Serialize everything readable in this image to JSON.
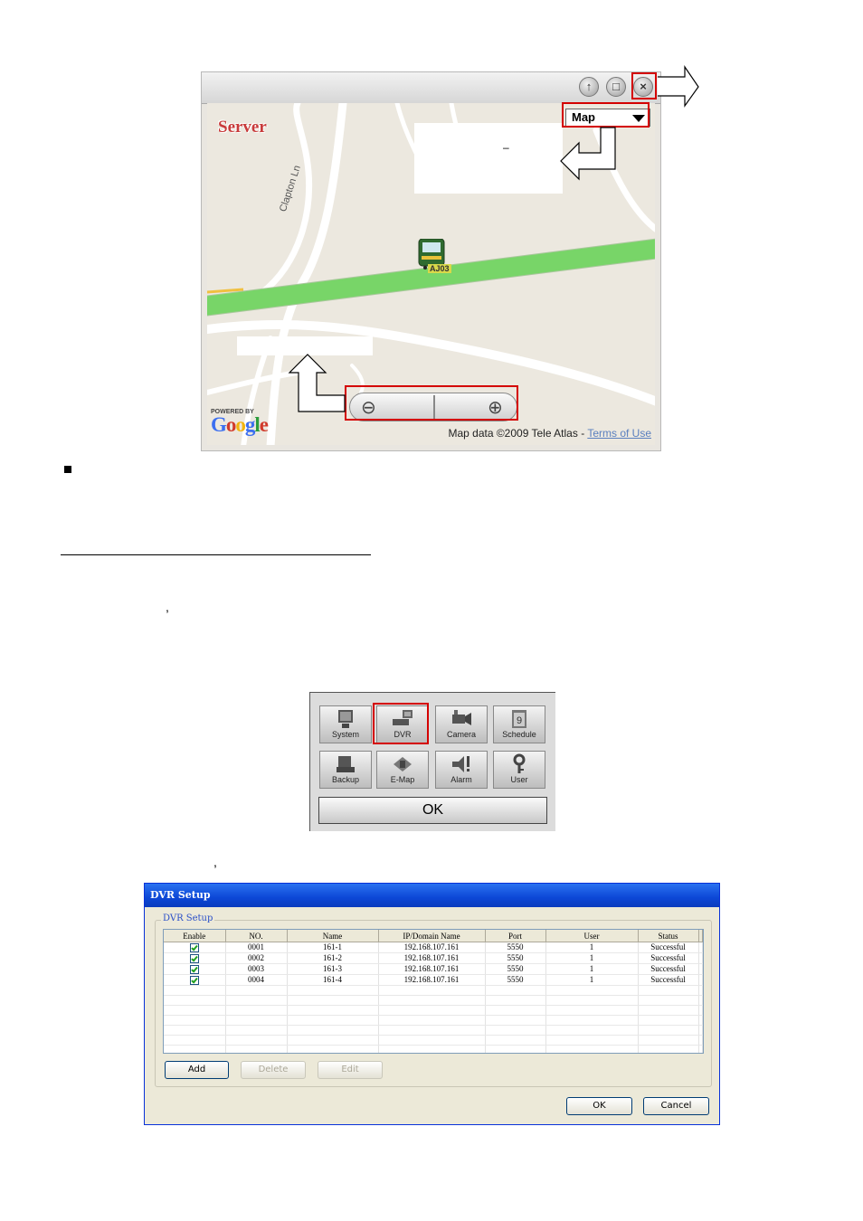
{
  "map_window": {
    "server_label": "Server",
    "street_label": "Clapton Ln",
    "map_type_value": "Map",
    "route_badge": "AJ03",
    "callout_dash": "–",
    "zoom_out_symbol": "⊖",
    "zoom_in_symbol": "⊕",
    "powered_by": "POWERED BY",
    "google_logo": [
      "G",
      "o",
      "o",
      "g",
      "l",
      "e"
    ],
    "attribution": "Map data ©2009 Tele Atlas - ",
    "terms_link": "Terms of Use",
    "colors": {
      "highway": "#78d568",
      "road": "#ffffff",
      "land": "#ece8df",
      "highlight": "#d40000",
      "google": [
        "#3c6ff0",
        "#d13b2c",
        "#f2b40e",
        "#3c6ff0",
        "#2c9c3c",
        "#d13b2c"
      ]
    }
  },
  "commas": [
    ",",
    ","
  ],
  "setup_toolbar": {
    "buttons": [
      {
        "id": "system",
        "label": "System",
        "icon": "monitor-icon"
      },
      {
        "id": "dvr",
        "label": "DVR",
        "icon": "dvr-icon"
      },
      {
        "id": "camera",
        "label": "Camera",
        "icon": "camera-icon"
      },
      {
        "id": "schedule",
        "label": "Schedule",
        "icon": "calendar-icon"
      },
      {
        "id": "backup",
        "label": "Backup",
        "icon": "backup-icon"
      },
      {
        "id": "emap",
        "label": "E-Map",
        "icon": "map-icon"
      },
      {
        "id": "alarm",
        "label": "Alarm",
        "icon": "alarm-icon"
      },
      {
        "id": "user",
        "label": "User",
        "icon": "key-icon"
      }
    ],
    "ok_label": "OK"
  },
  "dvr_setup": {
    "title": "DVR Setup",
    "group_label": "DVR Setup",
    "columns": [
      "Enable",
      "NO.",
      "Name",
      "IP/Domain Name",
      "Port",
      "User",
      "Status"
    ],
    "rows": [
      {
        "enabled": true,
        "no": "0001",
        "name": "161-1",
        "ip": "192.168.107.161",
        "port": "5550",
        "user": "1",
        "status": "Successful"
      },
      {
        "enabled": true,
        "no": "0002",
        "name": "161-2",
        "ip": "192.168.107.161",
        "port": "5550",
        "user": "1",
        "status": "Successful"
      },
      {
        "enabled": true,
        "no": "0003",
        "name": "161-3",
        "ip": "192.168.107.161",
        "port": "5550",
        "user": "1",
        "status": "Successful"
      },
      {
        "enabled": true,
        "no": "0004",
        "name": "161-4",
        "ip": "192.168.107.161",
        "port": "5550",
        "user": "1",
        "status": "Successful"
      }
    ],
    "add_label": "Add",
    "delete_label": "Delete",
    "edit_label": "Edit",
    "ok_label": "OK",
    "cancel_label": "Cancel"
  }
}
